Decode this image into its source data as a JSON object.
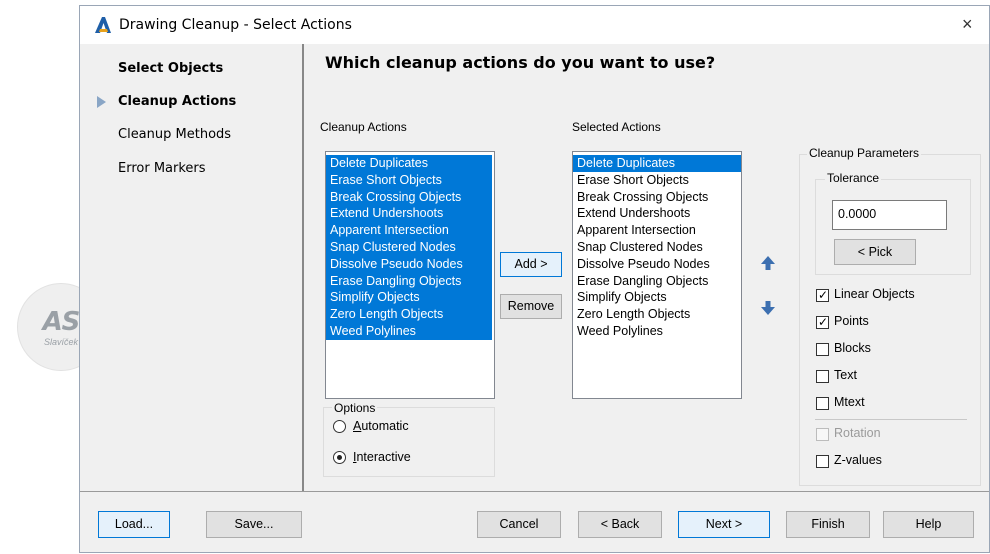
{
  "watermark": {
    "initials": "AS",
    "signature": "Slavíček"
  },
  "window": {
    "title": "Drawing Cleanup - Select Actions",
    "close_glyph": "×"
  },
  "nav": {
    "items": [
      {
        "label": "Select Objects",
        "bold": true
      },
      {
        "label": "Cleanup Actions",
        "bold": true,
        "current": true
      },
      {
        "label": "Cleanup Methods",
        "bold": false
      },
      {
        "label": "Error Markers",
        "bold": false
      }
    ]
  },
  "heading": "Which cleanup actions do you want to use?",
  "cleanup_actions": {
    "label": "Cleanup Actions",
    "items": [
      "Delete Duplicates",
      "Erase Short Objects",
      "Break Crossing Objects",
      "Extend Undershoots",
      "Apparent Intersection",
      "Snap Clustered Nodes",
      "Dissolve Pseudo Nodes",
      "Erase Dangling Objects",
      "Simplify Objects",
      "Zero Length Objects",
      "Weed Polylines"
    ]
  },
  "selected_actions": {
    "label": "Selected Actions",
    "selected_index": 0,
    "items": [
      "Delete Duplicates",
      "Erase Short Objects",
      "Break Crossing Objects",
      "Extend Undershoots",
      "Apparent Intersection",
      "Snap Clustered Nodes",
      "Dissolve Pseudo Nodes",
      "Erase Dangling Objects",
      "Simplify Objects",
      "Zero Length Objects",
      "Weed Polylines"
    ]
  },
  "buttons": {
    "add": "Add >",
    "remove": "Remove",
    "load": "Load...",
    "save": "Save...",
    "cancel": "Cancel",
    "back": "< Back",
    "next": "Next >",
    "finish": "Finish",
    "help": "Help",
    "pick": "< Pick"
  },
  "options": {
    "legend": "Options",
    "automatic": {
      "label": "Automatic",
      "checked": false
    },
    "interactive": {
      "label": "Interactive",
      "checked": true
    }
  },
  "parameters": {
    "legend": "Cleanup Parameters",
    "tolerance_legend": "Tolerance",
    "tolerance_value": "0.0000",
    "checkboxes": [
      {
        "label": "Linear Objects",
        "checked": true,
        "enabled": true
      },
      {
        "label": "Points",
        "checked": true,
        "enabled": true
      },
      {
        "label": "Blocks",
        "checked": false,
        "enabled": true
      },
      {
        "label": "Text",
        "checked": false,
        "enabled": true
      },
      {
        "label": "Mtext",
        "checked": false,
        "enabled": true
      },
      {
        "label": "Rotation",
        "checked": false,
        "enabled": false
      },
      {
        "label": "Z-values",
        "checked": false,
        "enabled": true
      }
    ]
  },
  "colors": {
    "selection": "#0078d7",
    "nav_arrow": "#8aa6c6",
    "app_icon": "#1f5fa8"
  }
}
